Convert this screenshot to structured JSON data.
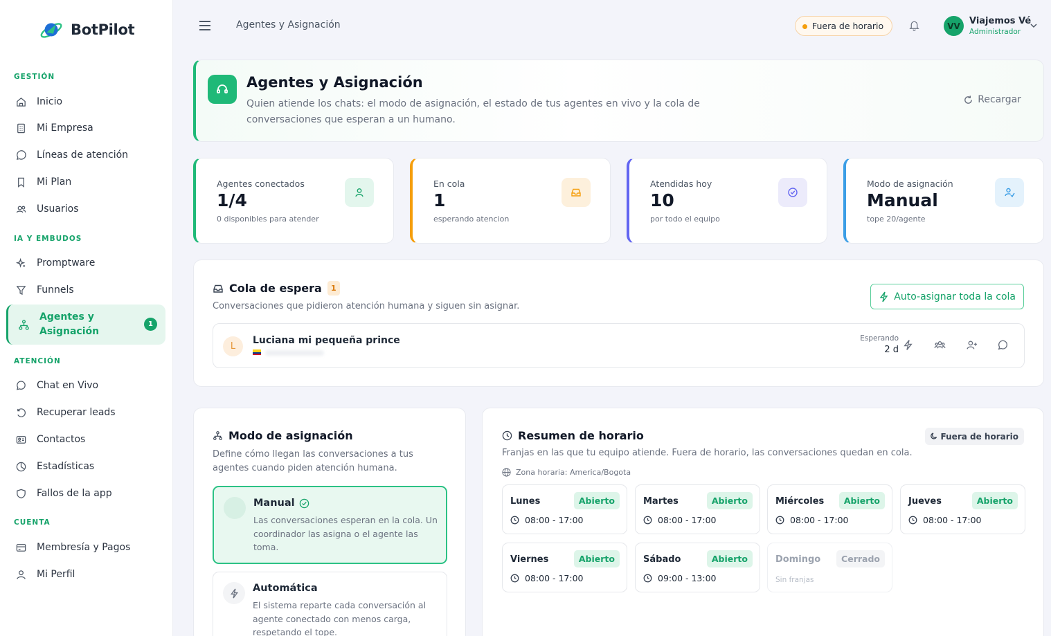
{
  "brand": {
    "name": "BotPilot"
  },
  "sidebar": {
    "sections": [
      {
        "title": "GESTIÓN",
        "items": [
          "Inicio",
          "Mi Empresa",
          "Líneas de atención",
          "Mi Plan",
          "Usuarios"
        ]
      },
      {
        "title": "IA Y EMBUDOS",
        "items": [
          "Promptware",
          "Funnels"
        ]
      },
      {
        "title": "ATENCIÓN",
        "items": [
          "Chat en Vivo",
          "Recuperar leads",
          "Contactos",
          "Estadísticas",
          "Fallos de la app"
        ]
      },
      {
        "title": "CUENTA",
        "items": [
          "Membresía y Pagos",
          "Mi Perfil"
        ]
      }
    ],
    "active": {
      "label": "Agentes y Asignación",
      "badge": "1"
    }
  },
  "header": {
    "breadcrumb": "Agentes y Asignación",
    "status_pill": "Fuera de horario",
    "user": {
      "initials": "VV",
      "name": "Viajemos Vé",
      "role": "Administrador"
    }
  },
  "hero": {
    "title": "Agentes y Asignación",
    "subtitle": "Quien atiende los chats: el modo de asignación, el estado de tus agentes en vivo y la cola de conversaciones que esperan a un humano.",
    "reload_label": "Recargar"
  },
  "stats": [
    {
      "label": "Agentes conectados",
      "value": "1/4",
      "sub": "0 disponibles para atender",
      "accent": "#1fb978"
    },
    {
      "label": "En cola",
      "value": "1",
      "sub": "esperando atencion",
      "accent": "#f59e0b"
    },
    {
      "label": "Atendidas hoy",
      "value": "10",
      "sub": "por todo el equipo",
      "accent": "#6366f1"
    },
    {
      "label": "Modo de asignación",
      "value": "Manual",
      "sub": "tope 20/agente",
      "accent": "#3b9ee6"
    }
  ],
  "queue": {
    "title": "Cola de espera",
    "count": "1",
    "subtitle": "Conversaciones que pidieron atención humana y siguen sin asignar.",
    "auto_assign_label": "Auto-asignar toda la cola",
    "rows": [
      {
        "initial": "L",
        "name": "Luciana mi pequeña prince",
        "wait_label": "Esperando",
        "wait_value": "2 d"
      }
    ]
  },
  "assignment_mode": {
    "title": "Modo de asignación",
    "subtitle": "Define cómo llegan las conversaciones a tus agentes cuando piden atención humana.",
    "options": [
      {
        "title": "Manual",
        "desc": "Las conversaciones esperan en la cola. Un coordinador las asigna o el agente las toma.",
        "selected": true
      },
      {
        "title": "Automática",
        "desc": "El sistema reparte cada conversación al agente conectado con menos carga, respetando el tope.",
        "selected": false
      }
    ]
  },
  "schedule": {
    "title": "Resumen de horario",
    "status": "Fuera de horario",
    "subtitle": "Franjas en las que tu equipo atiende. Fuera de horario, las conversaciones quedan en cola.",
    "timezone": "Zona horaria: America/Bogota",
    "days": [
      {
        "name": "Lunes",
        "tag": "Abierto",
        "time": "08:00 - 17:00",
        "open": true
      },
      {
        "name": "Martes",
        "tag": "Abierto",
        "time": "08:00 - 17:00",
        "open": true
      },
      {
        "name": "Miércoles",
        "tag": "Abierto",
        "time": "08:00 - 17:00",
        "open": true
      },
      {
        "name": "Jueves",
        "tag": "Abierto",
        "time": "08:00 - 17:00",
        "open": true
      },
      {
        "name": "Viernes",
        "tag": "Abierto",
        "time": "08:00 - 17:00",
        "open": true
      },
      {
        "name": "Sábado",
        "tag": "Abierto",
        "time": "09:00 - 13:00",
        "open": true
      },
      {
        "name": "Domingo",
        "tag": "Cerrado",
        "time": "Sin franjas",
        "open": false
      }
    ]
  }
}
